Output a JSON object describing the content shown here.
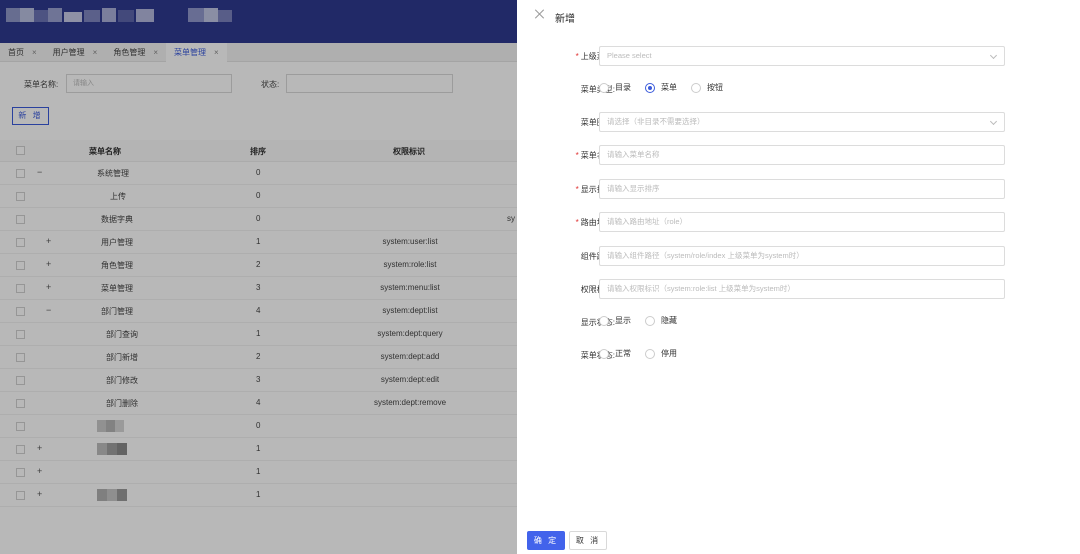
{
  "tabs": [
    {
      "label": "首页",
      "close": "×"
    },
    {
      "label": "用户管理",
      "close": "×"
    },
    {
      "label": "角色管理",
      "close": "×"
    },
    {
      "label": "菜单管理",
      "close": "×"
    }
  ],
  "search": {
    "name_label": "菜单名称:",
    "name_placeholder": "请输入",
    "status_label": "状态:",
    "status_placeholder": ""
  },
  "toolbar": {
    "add_label": "新 增"
  },
  "table": {
    "headers": [
      "菜单名称",
      "排序",
      "权限标识"
    ],
    "rows": [
      {
        "expander": "−",
        "name": "系统管理",
        "order": "0",
        "perm": ""
      },
      {
        "expander": "",
        "name": "上传",
        "order": "0",
        "perm": ""
      },
      {
        "expander": "",
        "name": "数据字典",
        "order": "0",
        "perm": ""
      },
      {
        "expander": "+",
        "name": "用户管理",
        "order": "1",
        "perm": "system:user:list"
      },
      {
        "expander": "+",
        "name": "角色管理",
        "order": "2",
        "perm": "system:role:list"
      },
      {
        "expander": "+",
        "name": "菜单管理",
        "order": "3",
        "perm": "system:menu:list"
      },
      {
        "expander": "−",
        "name": "部门管理",
        "order": "4",
        "perm": "system:dept:list"
      },
      {
        "expander": "",
        "name": "部门查询",
        "order": "1",
        "perm": "system:dept:query"
      },
      {
        "expander": "",
        "name": "部门新增",
        "order": "2",
        "perm": "system:dept:add"
      },
      {
        "expander": "",
        "name": "部门修改",
        "order": "3",
        "perm": "system:dept:edit"
      },
      {
        "expander": "",
        "name": "部门删除",
        "order": "4",
        "perm": "system:dept:remove"
      },
      {
        "expander": "",
        "name": "",
        "order": "0",
        "perm": ""
      },
      {
        "expander": "+",
        "name": "",
        "order": "1",
        "perm": ""
      },
      {
        "expander": "+",
        "name": "",
        "order": "1",
        "perm": ""
      },
      {
        "expander": "+",
        "name": "",
        "order": "1",
        "perm": ""
      }
    ],
    "partial_text": "sy"
  },
  "drawer": {
    "title": "新增",
    "parent_menu": {
      "label": "上级菜单:",
      "placeholder": "Please select"
    },
    "menu_type": {
      "label": "菜单类型:",
      "options": [
        "目录",
        "菜单",
        "按钮"
      ],
      "selected": "菜单"
    },
    "menu_icon": {
      "label": "菜单图标:",
      "placeholder": "请选择（非目录不需要选择）"
    },
    "menu_name": {
      "label": "菜单名称:",
      "placeholder": "请输入菜单名称"
    },
    "display_order": {
      "label": "显示排序:",
      "placeholder": "请输入显示排序"
    },
    "route": {
      "label": "路由地址:",
      "placeholder": "请输入路由地址（role）"
    },
    "component": {
      "label": "组件路径:",
      "placeholder": "请输入组件路径（system/role/index 上级菜单为system时）"
    },
    "permission": {
      "label": "权限标识:",
      "placeholder": "请输入权限标识（system:role:list 上级菜单为system时）"
    },
    "visible": {
      "label": "显示状态:",
      "options": [
        "显示",
        "隐藏"
      ]
    },
    "status": {
      "label": "菜单状态:",
      "options": [
        "正常",
        "停用"
      ]
    },
    "required_mark": "*",
    "ok_label": "确 定",
    "cancel_label": "取 消"
  },
  "colors": {
    "primary": "#3b5bdb",
    "header": "#2f3a8f",
    "required": "#e03131"
  }
}
